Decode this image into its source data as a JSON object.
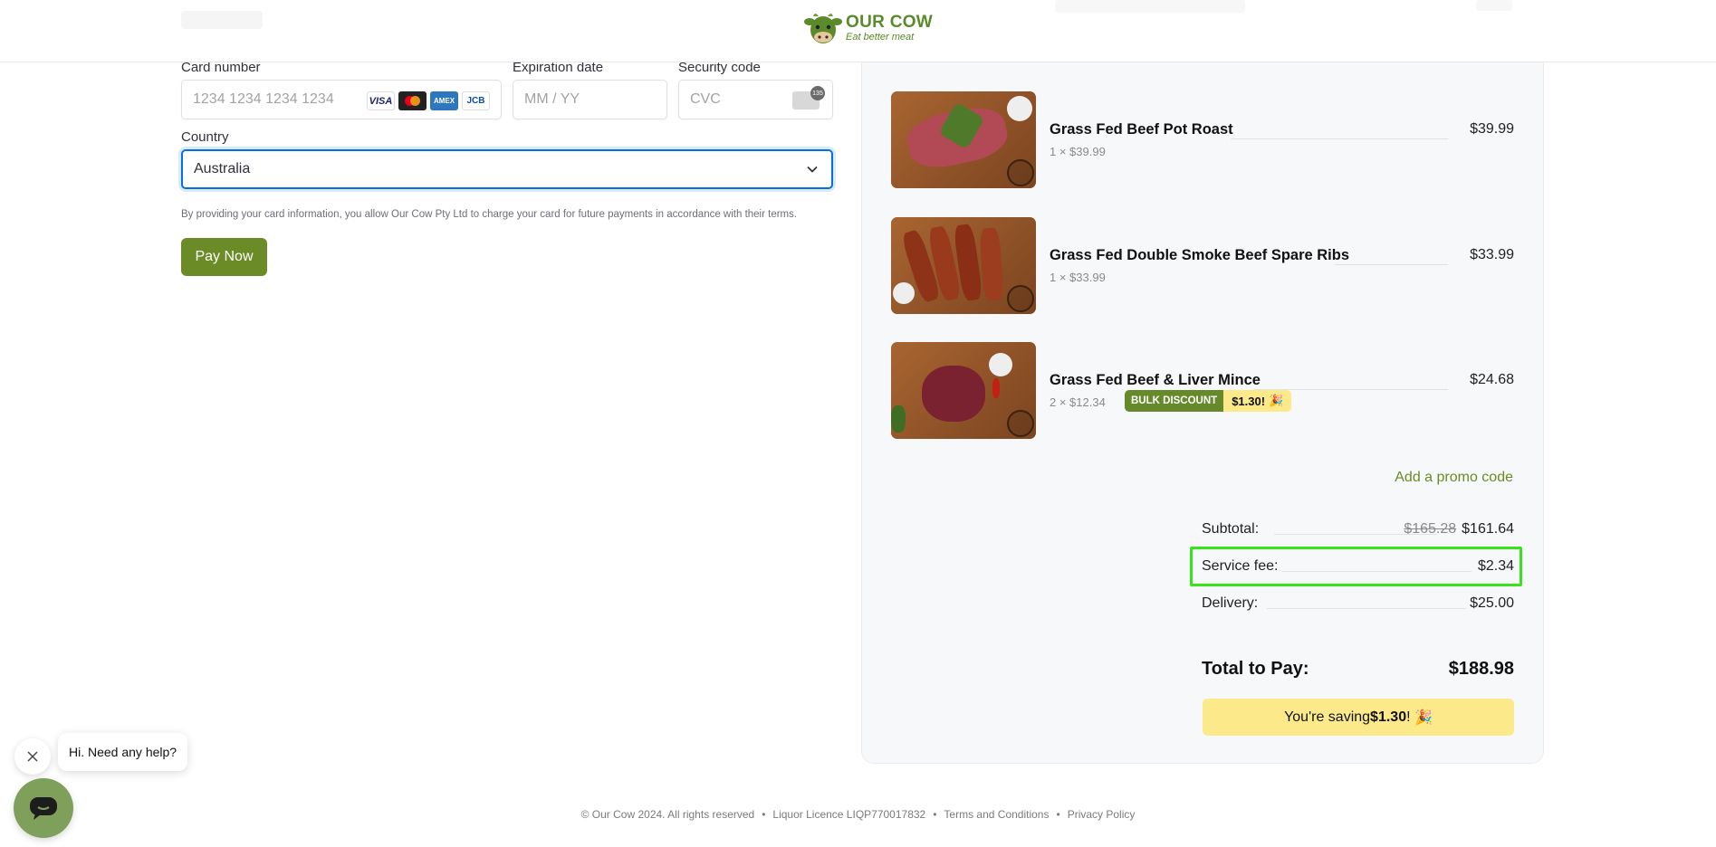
{
  "header": {
    "logo_title": "OUR COW",
    "logo_tagline": "Eat better meat"
  },
  "payment": {
    "card_number_label": "Card number",
    "card_number_placeholder": "1234 1234 1234 1234",
    "expiration_label": "Expiration date",
    "expiration_placeholder": "MM / YY",
    "security_label": "Security code",
    "security_placeholder": "CVC",
    "card_brands": [
      "VISA",
      "mastercard",
      "AMEX",
      "JCB"
    ],
    "cvc_badge": "135",
    "country_label": "Country",
    "country_value": "Australia",
    "terms": "By providing your card information, you allow Our Cow Pty Ltd to charge your card for future payments in accordance with their terms.",
    "pay_button": "Pay Now"
  },
  "cart": {
    "items": [
      {
        "name": "Grass Fed Beef Pot Roast",
        "qty": "1  ×  $39.99",
        "price": "$39.99"
      },
      {
        "name": "Grass Fed Double Smoke Beef Spare Ribs",
        "qty": "1  ×  $33.99",
        "price": "$33.99"
      },
      {
        "name": "Grass Fed Beef & Liver Mince",
        "qty": "2  ×  $12.34",
        "price": "$24.68",
        "badge_label": "BULK DISCOUNT",
        "badge_value": "$1.30!"
      }
    ],
    "promo_link": "Add a promo code",
    "subtotal_label": "Subtotal:",
    "subtotal_original": "$165.28",
    "subtotal_value": "$161.64",
    "service_fee_label": "Service fee:",
    "service_fee_value": "$2.34",
    "delivery_label": "Delivery:",
    "delivery_value": "$25.00",
    "total_label": "Total to Pay:",
    "total_value": "$188.98",
    "saving_prefix": "You're saving ",
    "saving_amount": "$1.30",
    "saving_suffix": "!",
    "accent_color": "#6a8b25",
    "highlight_color": "#39e21b",
    "saving_bg": "#fbe98a"
  },
  "footer": {
    "copyright": "© Our Cow 2024. All rights reserved",
    "licence": "Liquor Licence LIQP770017832",
    "terms": "Terms and Conditions",
    "privacy": "Privacy Policy"
  },
  "chat": {
    "message": "Hi. Need any help?"
  }
}
